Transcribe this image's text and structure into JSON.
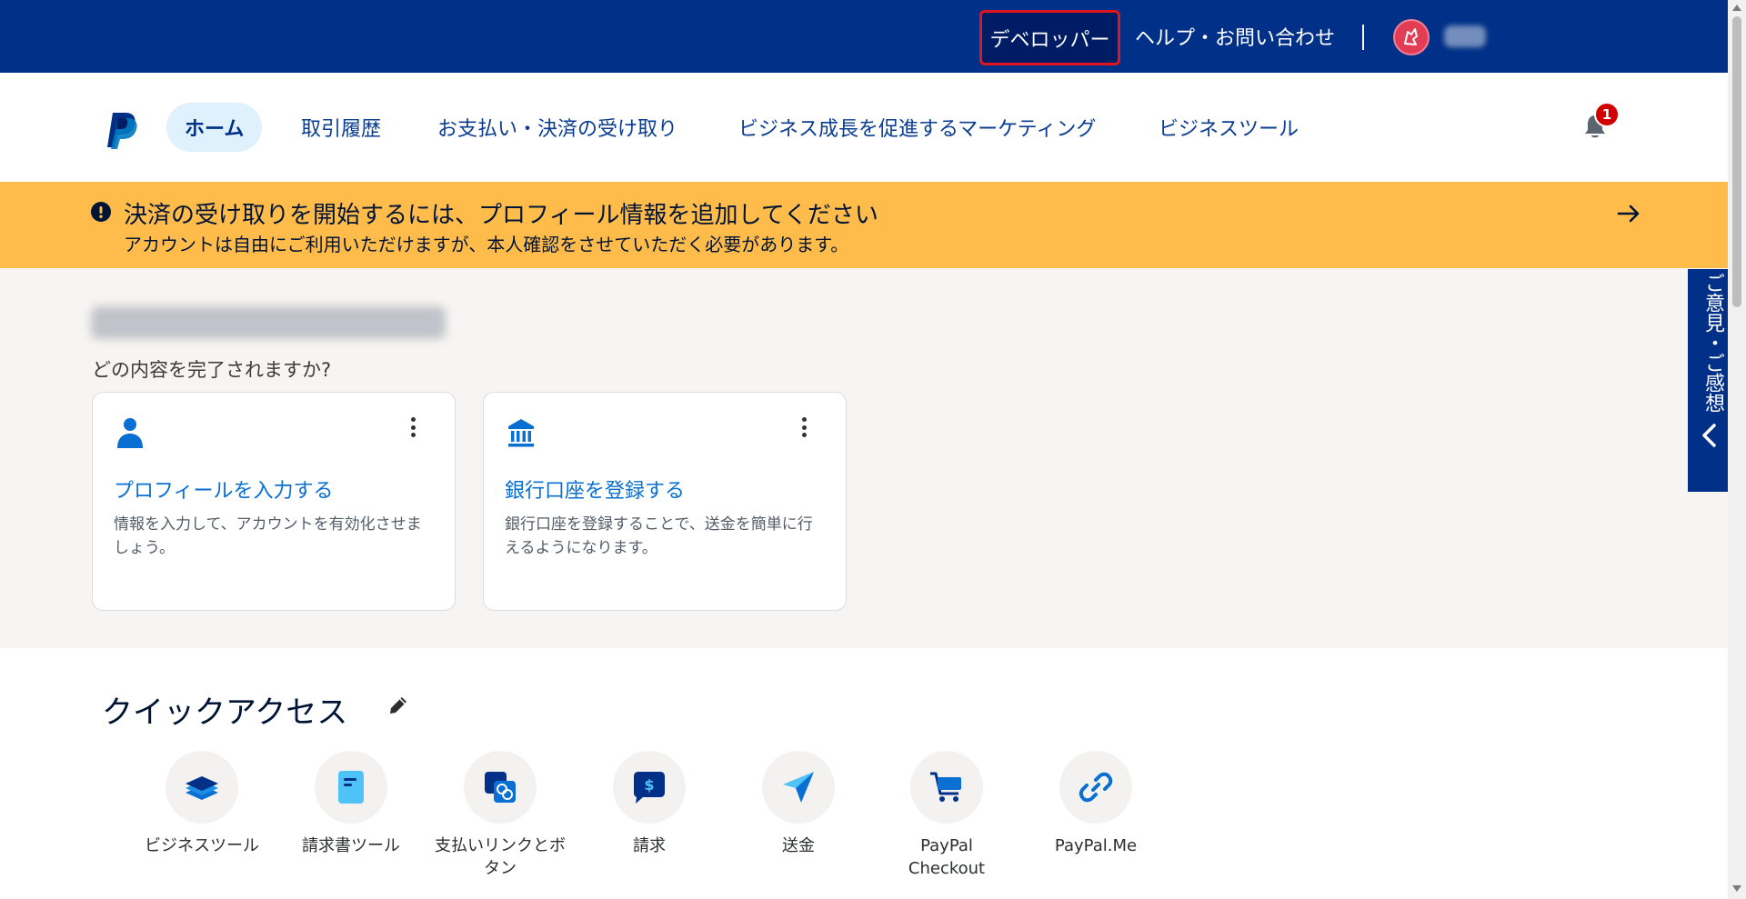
{
  "topbar": {
    "developer_label": "デベロッパー",
    "help_label": "ヘルプ・お問い合わせ",
    "avatar_icon": "user-avatar-icon",
    "colors": {
      "background": "#003087",
      "highlight_border": "#e0161e"
    }
  },
  "nav": {
    "logo_icon": "paypal-logo-icon",
    "items": [
      {
        "label": "ホーム",
        "active": true
      },
      {
        "label": "取引履歴"
      },
      {
        "label": "お支払い・決済の受け取り"
      },
      {
        "label": "ビジネス成長を促進するマーケティング"
      },
      {
        "label": "ビジネスツール"
      }
    ],
    "notification_icon": "bell-icon",
    "notification_count": "1"
  },
  "banner": {
    "icon": "alert-icon",
    "title": "決済の受け取りを開始するには、プロフィール情報を追加してください",
    "subtitle": "アカウントは自由にご利用いただけますが、本人確認をさせていただく必要があります。",
    "arrow_icon": "arrow-right-icon",
    "color": "#ffbc4b"
  },
  "tasks": {
    "question": "どの内容を完了されますか?",
    "cards": [
      {
        "icon": "person-icon",
        "title": "プロフィールを入力する",
        "description": "情報を入力して、アカウントを有効化させましょう。"
      },
      {
        "icon": "bank-icon",
        "title": "銀行口座を登録する",
        "description": "銀行口座を登録することで、送金を簡単に行えるようになります。"
      }
    ]
  },
  "quick_access": {
    "title": "クイックアクセス",
    "edit_icon": "pencil-icon",
    "items": [
      {
        "icon": "layers-icon",
        "label": "ビジネスツール"
      },
      {
        "icon": "invoice-icon",
        "label": "請求書ツール"
      },
      {
        "icon": "payment-links-icon",
        "label": "支払いリンクとボタン"
      },
      {
        "icon": "request-money-icon",
        "label": "請求"
      },
      {
        "icon": "send-icon",
        "label": "送金"
      },
      {
        "icon": "cart-icon",
        "label": "PayPal Checkout"
      },
      {
        "icon": "link-icon",
        "label": "PayPal.Me"
      }
    ]
  },
  "feedback": {
    "label": "ご意見・ご感想",
    "icon": "chevron-left-icon"
  }
}
